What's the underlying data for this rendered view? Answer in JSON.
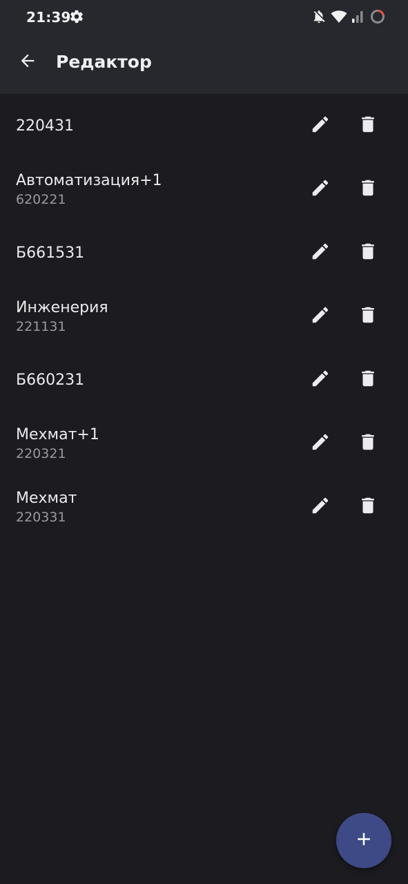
{
  "status_bar": {
    "time": "21:39",
    "icons": [
      "settings-gear-icon",
      "bell-off-icon",
      "wifi-icon",
      "cellular-signal-icon",
      "battery-ring-icon"
    ]
  },
  "app_bar": {
    "back_icon": "arrow-back-icon",
    "title": "Редактор"
  },
  "items": [
    {
      "title": "220431",
      "subtitle": ""
    },
    {
      "title": "Автоматизация+1",
      "subtitle": "620221"
    },
    {
      "title": "Б661531",
      "subtitle": ""
    },
    {
      "title": "Инженерия",
      "subtitle": "221131"
    },
    {
      "title": "Б660231",
      "subtitle": ""
    },
    {
      "title": "Мехмат+1",
      "subtitle": "220321"
    },
    {
      "title": "Мехмат",
      "subtitle": "220331"
    }
  ],
  "row_actions": {
    "edit_icon": "pencil-icon",
    "delete_icon": "trash-icon"
  },
  "fab": {
    "icon": "plus-icon"
  },
  "colors": {
    "background": "#1c1b20",
    "bar": "#26282e",
    "fab": "#3d4a85",
    "text_primary": "#ebebee",
    "text_secondary": "#9a9aa2"
  }
}
